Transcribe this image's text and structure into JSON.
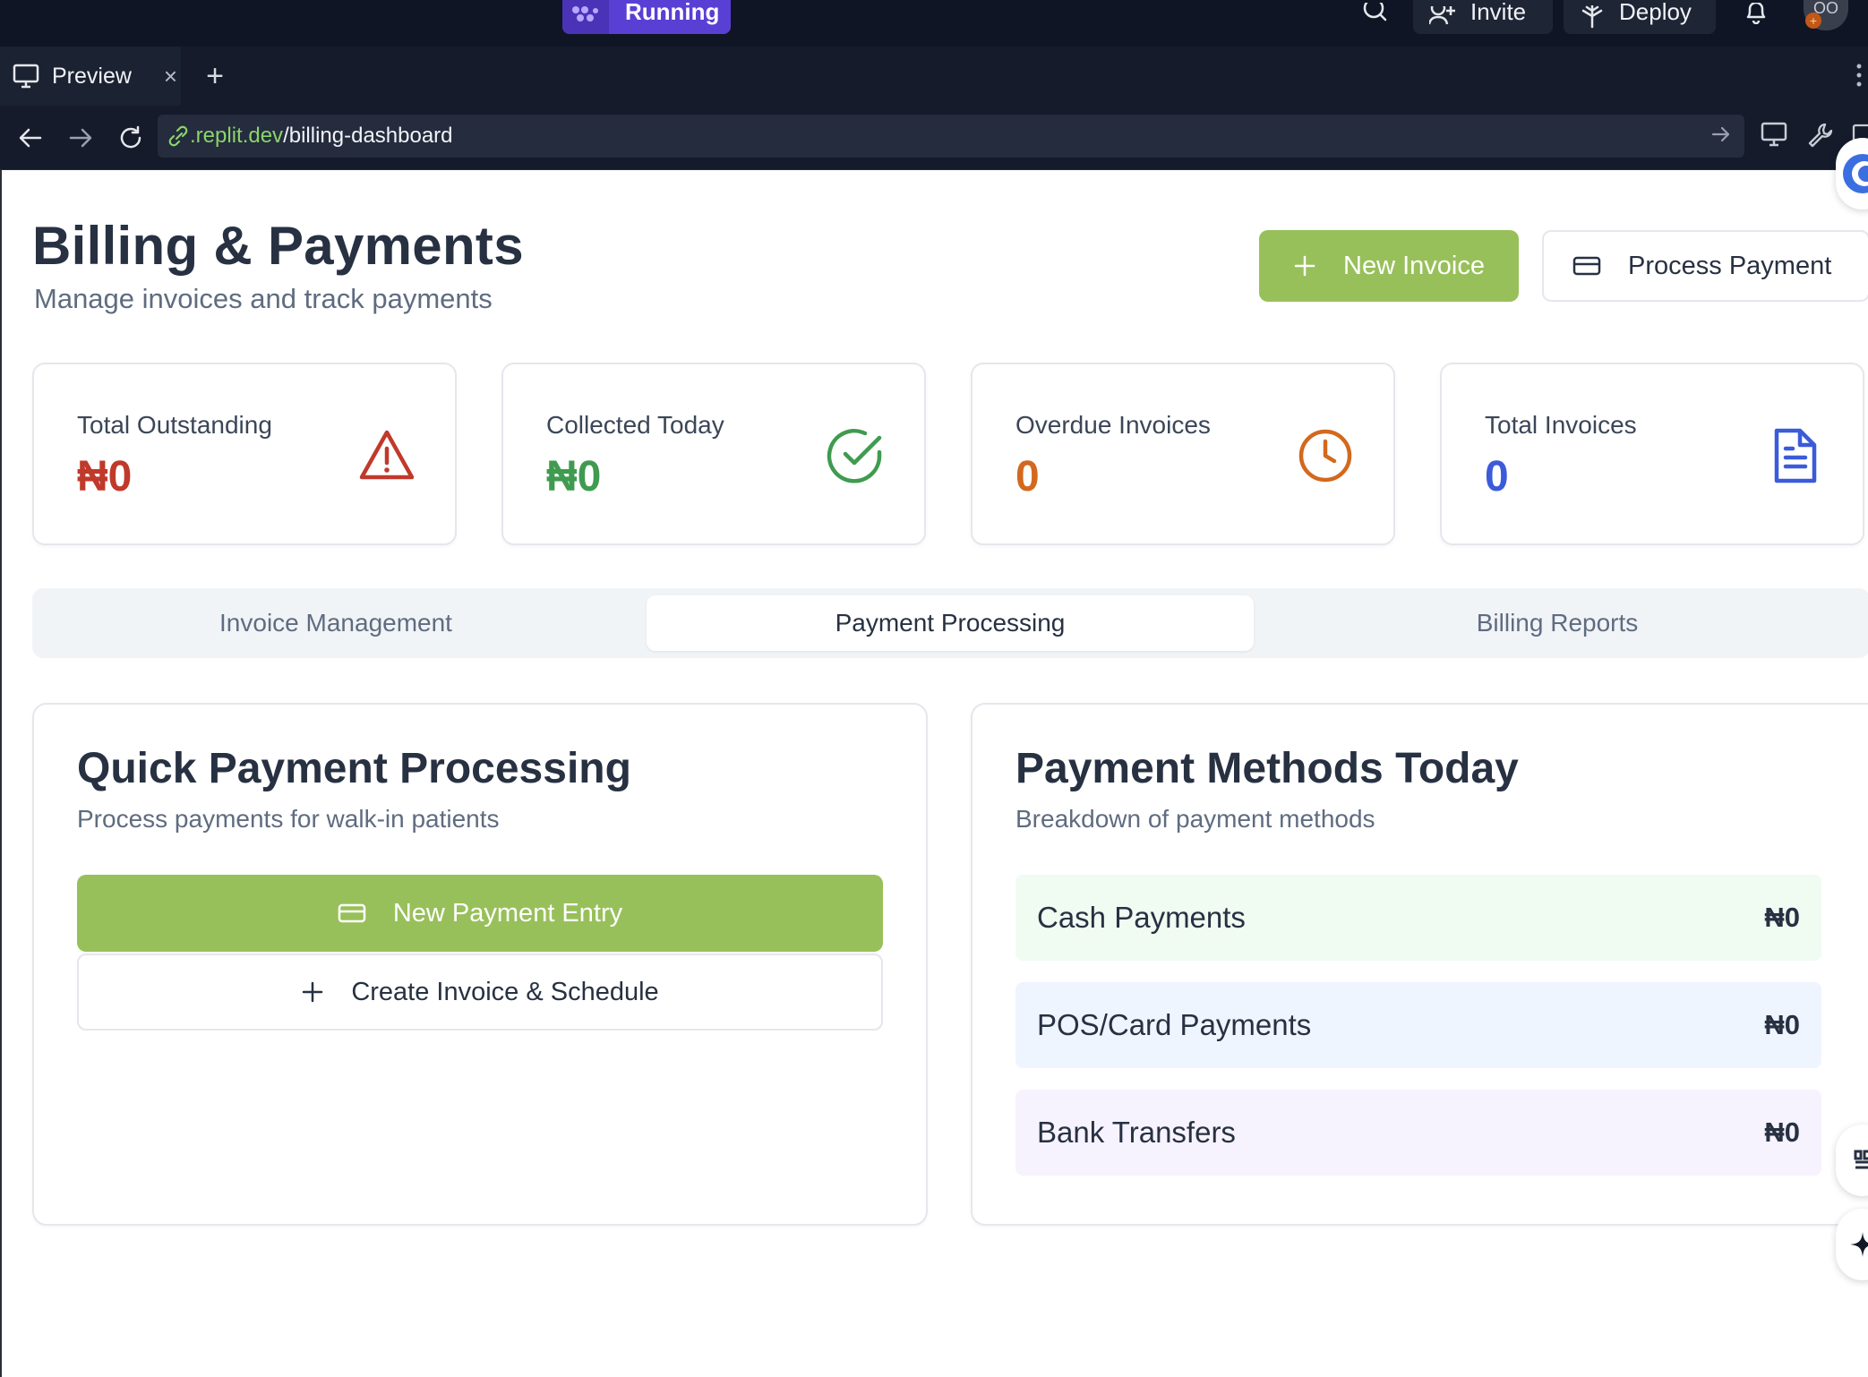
{
  "topbar": {
    "status_label": "Running",
    "invite_label": "Invite",
    "deploy_label": "Deploy",
    "avatar_initials": "OO",
    "avatar_badge": "+"
  },
  "browser": {
    "tab_label": "Preview",
    "tab_close": "×",
    "tab_add": "+",
    "url_host": ".replit.dev",
    "url_path": "/billing-dashboard"
  },
  "header": {
    "title": "Billing & Payments",
    "subtitle": "Manage invoices and track payments",
    "new_invoice_label": "New Invoice",
    "process_payment_label": "Process Payment"
  },
  "stats": [
    {
      "label": "Total Outstanding",
      "value": "₦0",
      "color": "#c0392b",
      "icon": "alert-triangle-icon"
    },
    {
      "label": "Collected Today",
      "value": "₦0",
      "color": "#3f9b4f",
      "icon": "check-circle-icon"
    },
    {
      "label": "Overdue Invoices",
      "value": "0",
      "color": "#d2691e",
      "icon": "clock-icon"
    },
    {
      "label": "Total Invoices",
      "value": "0",
      "color": "#3b5bdb",
      "icon": "file-text-icon"
    }
  ],
  "tabs": [
    {
      "label": "Invoice Management",
      "active": false
    },
    {
      "label": "Payment Processing",
      "active": true
    },
    {
      "label": "Billing Reports",
      "active": false
    }
  ],
  "quick_payment": {
    "title": "Quick Payment Processing",
    "subtitle": "Process payments for walk-in patients",
    "new_entry_label": "New Payment Entry",
    "create_invoice_label": "Create Invoice & Schedule"
  },
  "methods": {
    "title": "Payment Methods Today",
    "subtitle": "Breakdown of payment methods",
    "items": [
      {
        "label": "Cash Payments",
        "amount": "₦0",
        "bg": "#f0fbf2"
      },
      {
        "label": "POS/Card Payments",
        "amount": "₦0",
        "bg": "#eff5fe"
      },
      {
        "label": "Bank Transfers",
        "amount": "₦0",
        "bg": "#f7f3fe"
      }
    ]
  },
  "colors": {
    "accent_green": "#98c05a",
    "running_purple": "#5a3fd4",
    "text_dark": "#273142"
  }
}
